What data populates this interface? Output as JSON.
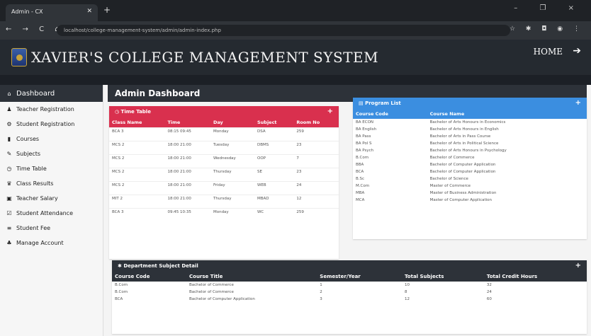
{
  "browser": {
    "tab_title": "Admin - CX",
    "url": "localhost/college-management-system/admin/admin-index.php",
    "nav_icons": "← → C ⌂",
    "window_controls": "– ❐ ×"
  },
  "header": {
    "title": "XAVIER'S COLLEGE MANAGEMENT SYSTEM",
    "home_label": "HOME"
  },
  "sidebar": {
    "items": [
      {
        "label": "Dashboard",
        "icon": "home-icon",
        "glyph": "⌂"
      },
      {
        "label": "Teacher Registration",
        "icon": "user-icon",
        "glyph": "♟"
      },
      {
        "label": "Student Registration",
        "icon": "gear-icon",
        "glyph": "⚙"
      },
      {
        "label": "Courses",
        "icon": "book-icon",
        "glyph": "▮"
      },
      {
        "label": "Subjects",
        "icon": "edit-icon",
        "glyph": "✎"
      },
      {
        "label": "Time Table",
        "icon": "clock-icon",
        "glyph": "◷"
      },
      {
        "label": "Class Results",
        "icon": "trophy-icon",
        "glyph": "♛"
      },
      {
        "label": "Teacher Salary",
        "icon": "money-icon",
        "glyph": "▣"
      },
      {
        "label": "Student Attendance",
        "icon": "check-icon",
        "glyph": "☑"
      },
      {
        "label": "Student Fee",
        "icon": "list-icon",
        "glyph": "≡"
      },
      {
        "label": "Manage Account",
        "icon": "users-icon",
        "glyph": "♣"
      }
    ]
  },
  "main": {
    "page_title": "Admin Dashboard",
    "timetable": {
      "title": "Time Table",
      "columns": [
        "Class Name",
        "Time",
        "Day",
        "Subject",
        "Room No"
      ],
      "rows": [
        [
          "BCA 3",
          "08:15 09:45",
          "Monday",
          "DSA",
          "259"
        ],
        [
          "MCS 2",
          "18:00 21:00",
          "Tuesday",
          "DBMS",
          "23"
        ],
        [
          "MCS 2",
          "18:00 21:00",
          "Wednesday",
          "OOP",
          "7"
        ],
        [
          "MCS 2",
          "18:00 21:00",
          "Thursday",
          "SE",
          "23"
        ],
        [
          "MCS 2",
          "18:00 21:00",
          "Friday",
          "WEB",
          "24"
        ],
        [
          "MIT 2",
          "18:00 21:00",
          "Thursday",
          "MBAD",
          "12"
        ],
        [
          "BCA 3",
          "09:45 10:35",
          "Monday",
          "WC",
          "259"
        ]
      ]
    },
    "programs": {
      "title": "Program List",
      "columns": [
        "Course Code",
        "Course Name"
      ],
      "rows": [
        [
          "BA ECON",
          "Bachelor of Arts Honours in Economics"
        ],
        [
          "BA English",
          "Bachelor of Arts Honours in English"
        ],
        [
          "BA Pass",
          "Bachelor of Arts in Pass Course"
        ],
        [
          "BA Pol S",
          "Bachelor of Arts in Political Science"
        ],
        [
          "BA Psych",
          "Bachelor of Arts Honours in Psychology"
        ],
        [
          "B.Com",
          "Bachelor of Commerce"
        ],
        [
          "BBA",
          "Bachelor of Computer Application"
        ],
        [
          "BCA",
          "Bachelor of Computer Application"
        ],
        [
          "B.Sc",
          "Bachelor of Science"
        ],
        [
          "M.Com",
          "Master of Commerce"
        ],
        [
          "MBA",
          "Master of Business Administration"
        ],
        [
          "MCA",
          "Master of Computer Application"
        ]
      ]
    },
    "department": {
      "title": "Department Subject Detail",
      "columns": [
        "Course Code",
        "Course Title",
        "Semester/Year",
        "Total Subjects",
        "Total Credit Hours"
      ],
      "rows": [
        [
          "B.Com",
          "Bachelor of Commerce",
          "1",
          "10",
          "32"
        ],
        [
          "B.Com",
          "Bachelor of Commerce",
          "2",
          "8",
          "24"
        ],
        [
          "BCA",
          "Bachelor of Computer Application",
          "3",
          "12",
          "60"
        ]
      ]
    }
  }
}
